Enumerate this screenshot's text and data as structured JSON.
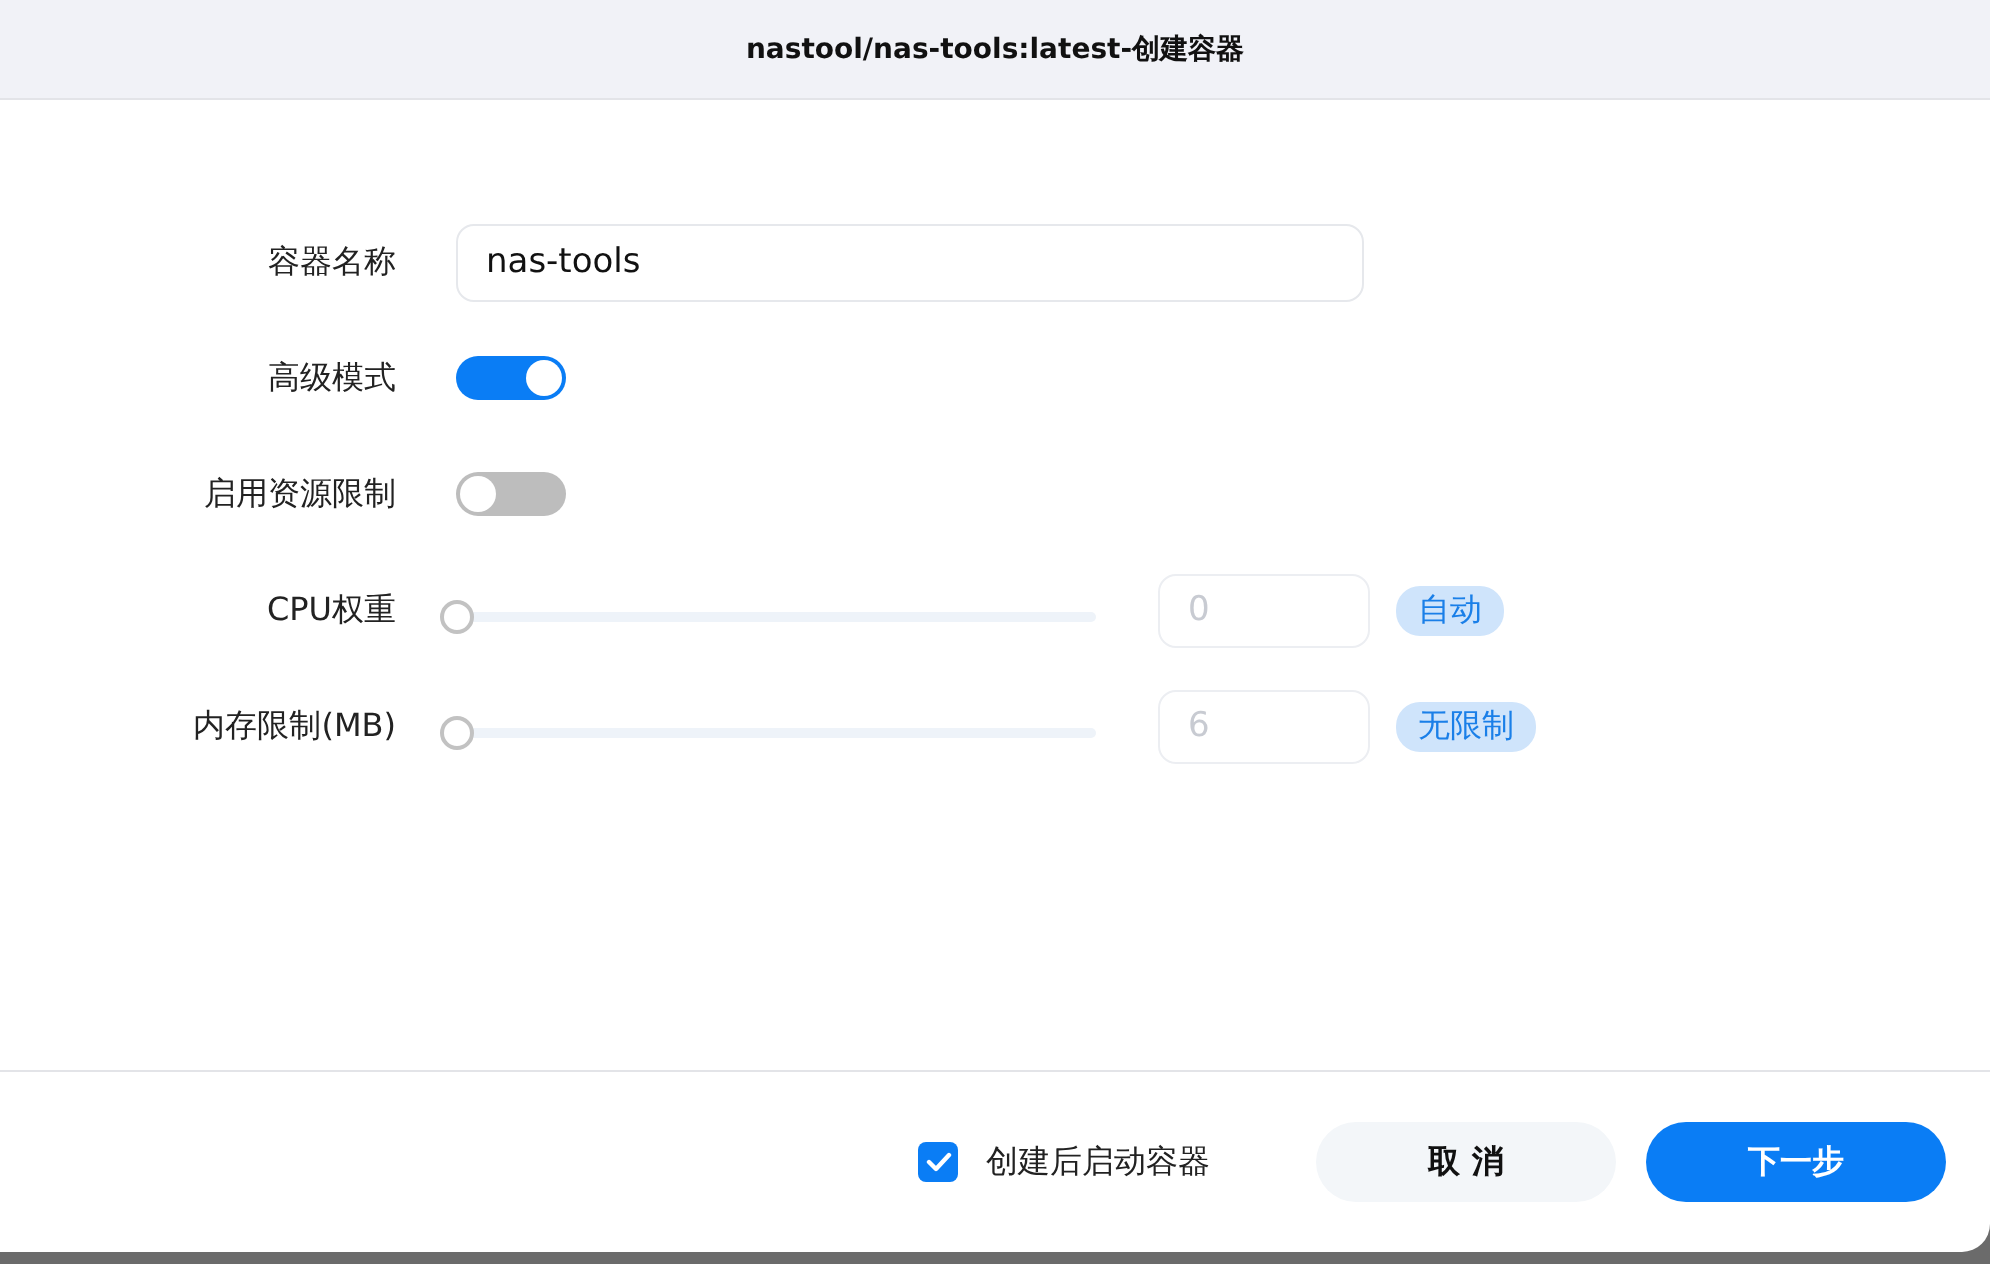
{
  "window": {
    "title": "nastool/nas-tools:latest-创建容器"
  },
  "fields": [
    {
      "kind": "text",
      "label": "容器名称",
      "value": "nas-tools"
    },
    {
      "kind": "switch",
      "label": "高级模式",
      "on": true
    },
    {
      "kind": "switch",
      "label": "启用资源限制",
      "on": false
    },
    {
      "kind": "slider",
      "label": "CPU权重",
      "level": 0,
      "value": "0",
      "badge": "自动",
      "disabled": true
    },
    {
      "kind": "slider",
      "label": "内存限制(MB)",
      "level": 0,
      "value": "6",
      "badge": "无限制",
      "disabled": true
    }
  ],
  "footer": {
    "checkbox": {
      "label": "创建后启动容器",
      "checked": true
    },
    "buttons": [
      {
        "label": "取 消",
        "kind": "secondary"
      },
      {
        "label": "下一步",
        "kind": "primary"
      }
    ]
  }
}
